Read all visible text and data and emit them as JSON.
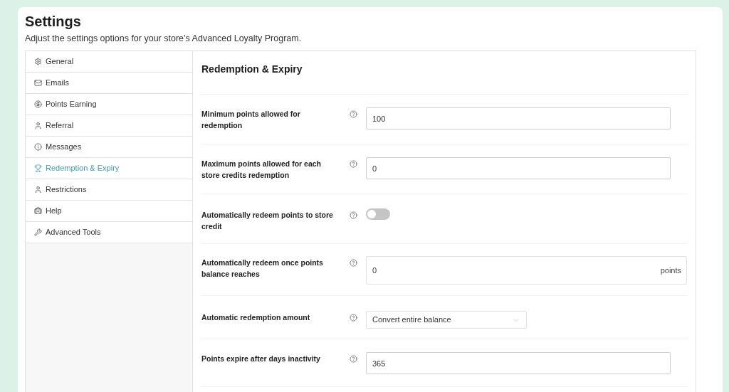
{
  "header": {
    "title": "Settings",
    "subtitle": "Adjust the settings options for your store’s Advanced Loyalty Program."
  },
  "sidebar": {
    "items": [
      {
        "label": "General",
        "selected": false
      },
      {
        "label": "Emails",
        "selected": false
      },
      {
        "label": "Points Earning",
        "selected": false
      },
      {
        "label": "Referral",
        "selected": false
      },
      {
        "label": "Messages",
        "selected": false
      },
      {
        "label": "Redemption & Expiry",
        "selected": true
      },
      {
        "label": "Restrictions",
        "selected": false
      },
      {
        "label": "Help",
        "selected": false
      },
      {
        "label": "Advanced Tools",
        "selected": false
      }
    ]
  },
  "section": {
    "title": "Redemption & Expiry",
    "rows": [
      {
        "kind": "input",
        "label": "Minimum points allowed for redemption",
        "value": "100"
      },
      {
        "kind": "input",
        "label": "Maximum points allowed for each store credits redemption",
        "value": "0"
      },
      {
        "kind": "toggle",
        "label": "Automatically redeem points to store credit",
        "on": false
      },
      {
        "kind": "suffix",
        "label": "Automatically redeem once points balance reaches",
        "value": "0",
        "suffix": "points"
      },
      {
        "kind": "select",
        "label": "Automatic redemption amount",
        "value": "Convert entire balance"
      },
      {
        "kind": "input",
        "label": "Points expire after days inactivity",
        "value": "365"
      }
    ]
  }
}
